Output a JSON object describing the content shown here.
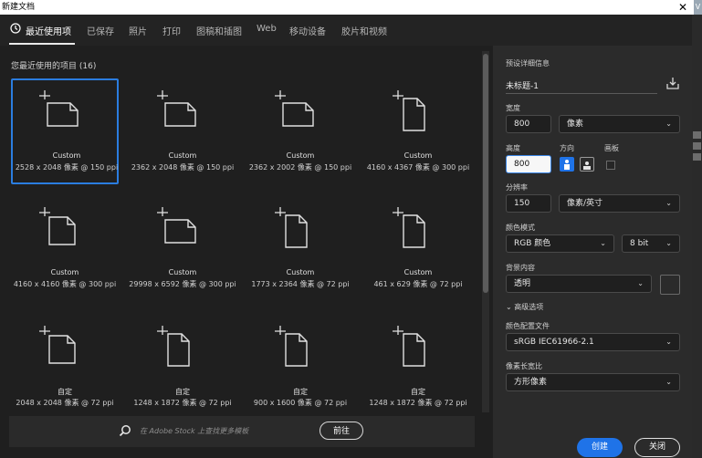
{
  "window": {
    "title": "新建文档",
    "close_glyph": "✕",
    "edge_text": "V"
  },
  "tabs": [
    {
      "label": "最近使用项"
    },
    {
      "label": "已保存"
    },
    {
      "label": "照片"
    },
    {
      "label": "打印"
    },
    {
      "label": "图稿和插图"
    },
    {
      "label": "Web"
    },
    {
      "label": "移动设备"
    },
    {
      "label": "胶片和视频"
    }
  ],
  "recent": {
    "title": "您最近使用的项目 (16)",
    "items": [
      {
        "name": "Custom",
        "dims": "2528 x 2048 像素 @ 150 ppi",
        "orientation": "landscape"
      },
      {
        "name": "Custom",
        "dims": "2362 x 2048 像素 @ 150 ppi",
        "orientation": "landscape"
      },
      {
        "name": "Custom",
        "dims": "2362 x 2002 像素 @ 150 ppi",
        "orientation": "landscape"
      },
      {
        "name": "Custom",
        "dims": "4160 x 4367 像素 @ 300 ppi",
        "orientation": "portrait"
      },
      {
        "name": "Custom",
        "dims": "4160 x 4160 像素 @ 300 ppi",
        "orientation": "square"
      },
      {
        "name": "Custom",
        "dims": "29998 x 6592 像素 @ 300 ppi",
        "orientation": "landscape"
      },
      {
        "name": "Custom",
        "dims": "1773 x 2364 像素 @ 72 ppi",
        "orientation": "portrait"
      },
      {
        "name": "Custom",
        "dims": "461 x 629 像素 @ 72 ppi",
        "orientation": "portrait"
      },
      {
        "name": "自定",
        "dims": "2048 x 2048 像素 @ 72 ppi",
        "orientation": "square"
      },
      {
        "name": "自定",
        "dims": "1248 x 1872 像素 @ 72 ppi",
        "orientation": "portrait"
      },
      {
        "name": "自定",
        "dims": "900 x 1600 像素 @ 72 ppi",
        "orientation": "portrait"
      },
      {
        "name": "自定",
        "dims": "1248 x 1872 像素 @ 72 ppi",
        "orientation": "portrait"
      }
    ]
  },
  "search": {
    "placeholder": "在 Adobe Stock 上查找更多模板",
    "go_label": "前往"
  },
  "preset": {
    "section_label": "预设详细信息",
    "name": "未标题-1",
    "width_label": "宽度",
    "width_value": "800",
    "width_unit": "像素",
    "height_label": "高度",
    "height_value": "800",
    "orientation_label": "方向",
    "artboard_label": "画板",
    "resolution_label": "分辨率",
    "resolution_value": "150",
    "resolution_unit": "像素/英寸",
    "color_mode_label": "颜色模式",
    "color_mode_value": "RGB 颜色",
    "bit_depth_value": "8 bit",
    "background_label": "背景内容",
    "background_value": "透明",
    "advanced_label": "高级选项",
    "color_profile_label": "颜色配置文件",
    "color_profile_value": "sRGB IEC61966-2.1",
    "pixel_aspect_label": "像素长宽比",
    "pixel_aspect_value": "方形像素",
    "chevron_glyph": "⌄",
    "advanced_glyph": "⌄"
  },
  "actions": {
    "create_label": "创建",
    "close_label": "关闭"
  },
  "colors": {
    "accent": "#1f73e8",
    "selected_border": "#2b7de0"
  }
}
